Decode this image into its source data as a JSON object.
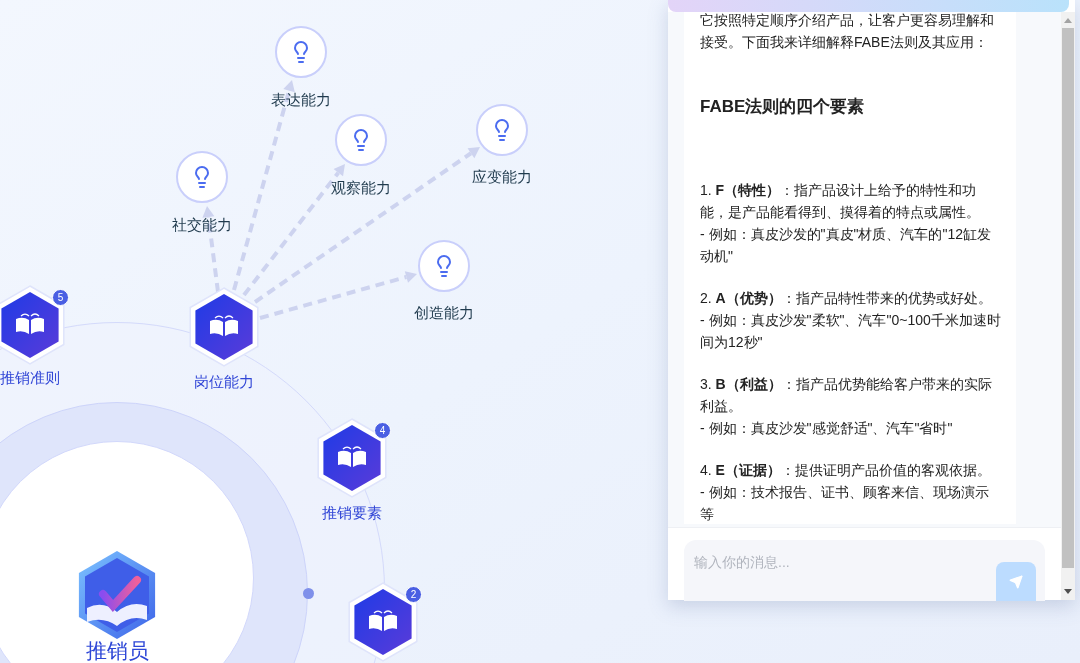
{
  "map": {
    "center": {
      "label": "推销员"
    },
    "hubs": [
      {
        "label": "推销准则",
        "badge": "5"
      },
      {
        "label": "岗位能力"
      },
      {
        "label": "推销要素",
        "badge": "4"
      },
      {
        "badge": "2"
      }
    ],
    "skills": [
      {
        "label": "表达能力"
      },
      {
        "label": "观察能力"
      },
      {
        "label": "应变能力"
      },
      {
        "label": "社交能力"
      },
      {
        "label": "创造能力"
      }
    ]
  },
  "chat": {
    "intro": "它按照特定顺序介绍产品，让客户更容易理解和接受。下面我来详细解释FABE法则及其应用：",
    "heading": "FABE法则的四个要素",
    "items": [
      {
        "definition": "1. **F（特性）**：指产品设计上给予的特性和功能，是产品能看得到、摸得着的特点或属性。",
        "example": "- 例如：真皮沙发的\"真皮\"材质、汽车的\"12缸发动机\""
      },
      {
        "definition": "2. **A（优势）**：指产品特性带来的优势或好处。",
        "example": "- 例如：真皮沙发\"柔软\"、汽车\"0~100千米加速时间为12秒\""
      },
      {
        "definition": "3. **B（利益）**：指产品优势能给客户带来的实际利益。",
        "example": "- 例如：真皮沙发\"感觉舒适\"、汽车\"省时\""
      },
      {
        "definition": "4. **E（证据）**：提供证明产品价值的客观依据。",
        "example": "- 例如：技术报告、证书、顾客来信、现场演示等"
      }
    ],
    "input": {
      "placeholder": "输入你的消息..."
    }
  }
}
